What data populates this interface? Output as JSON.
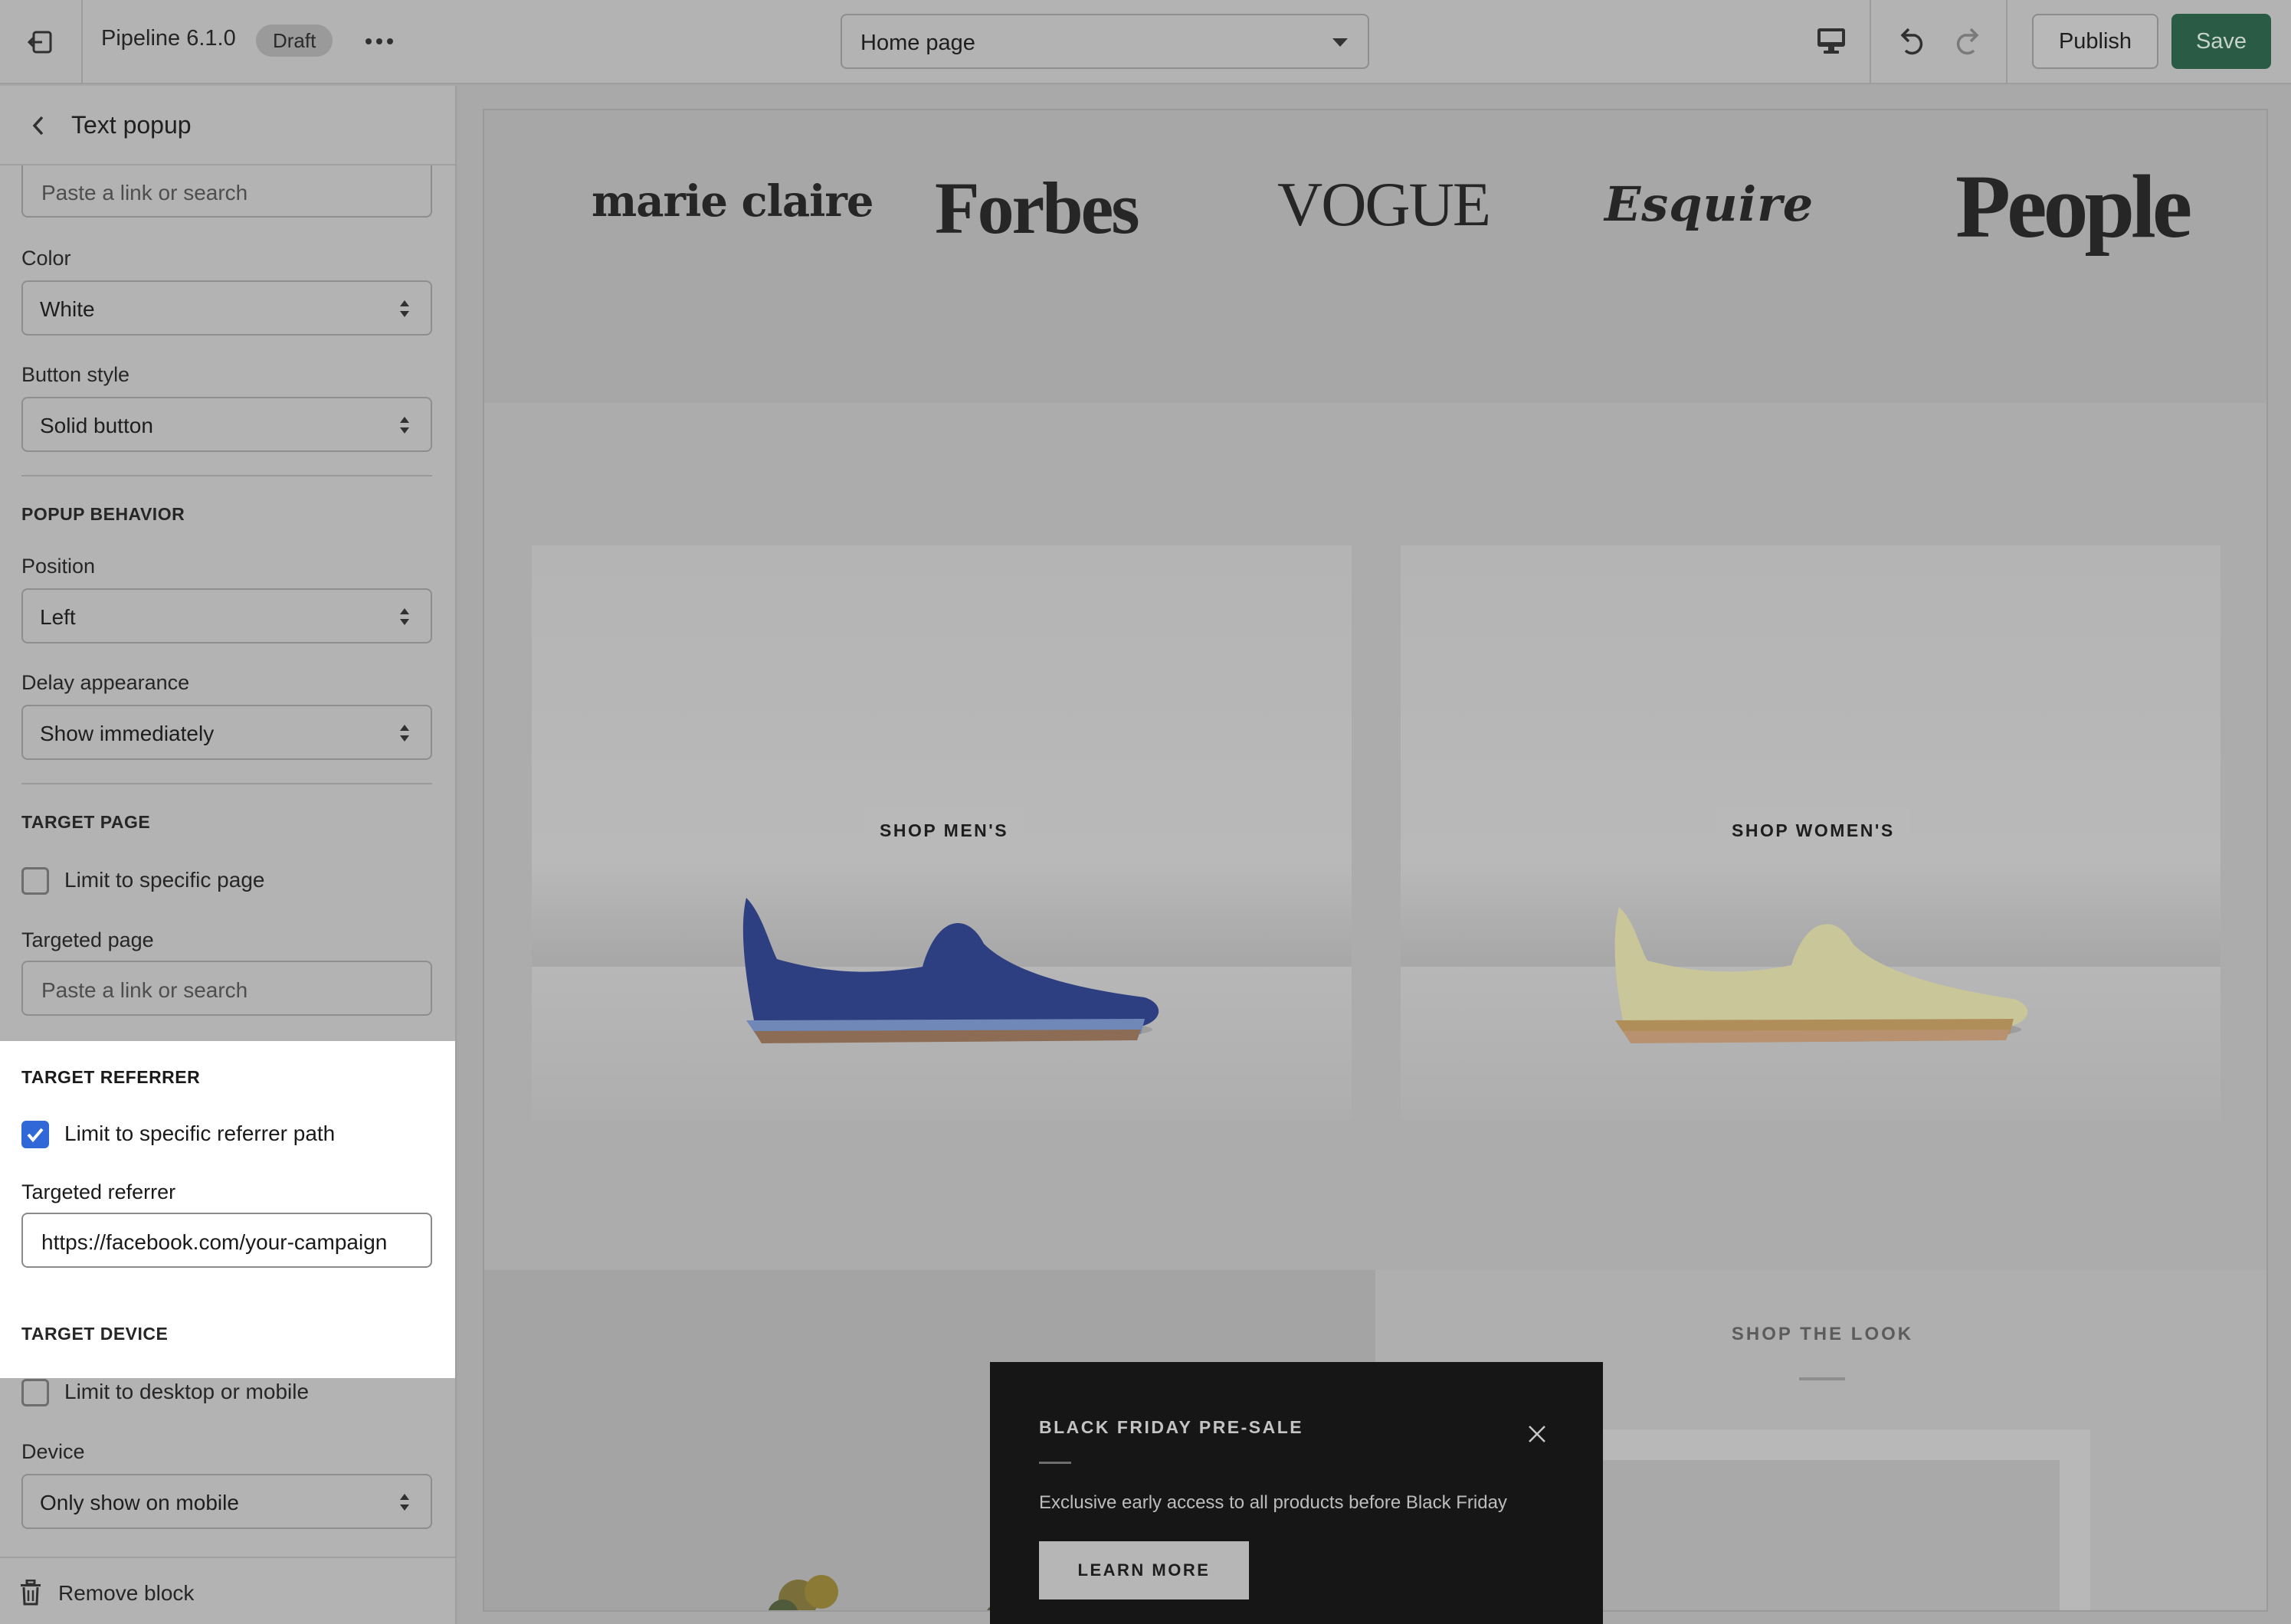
{
  "topbar": {
    "theme_name": "Pipeline 6.1.0",
    "status_badge": "Draft",
    "page_selector": "Home page",
    "publish_label": "Publish",
    "save_label": "Save"
  },
  "sidebar": {
    "title": "Text popup",
    "link_placeholder": "Paste a link or search",
    "color": {
      "label": "Color",
      "value": "White"
    },
    "button_style": {
      "label": "Button style",
      "value": "Solid button"
    },
    "popup_behavior": {
      "heading": "POPUP BEHAVIOR",
      "position": {
        "label": "Position",
        "value": "Left"
      },
      "delay": {
        "label": "Delay appearance",
        "value": "Show immediately"
      }
    },
    "target_page": {
      "heading": "TARGET PAGE",
      "checkbox_label": "Limit to specific page",
      "checked": false,
      "field_label": "Targeted page",
      "placeholder": "Paste a link or search"
    },
    "target_referrer": {
      "heading": "TARGET REFERRER",
      "checkbox_label": "Limit to specific referrer path",
      "checked": true,
      "field_label": "Targeted referrer",
      "value": "https://facebook.com/your-campaign"
    },
    "target_device": {
      "heading": "TARGET DEVICE",
      "checkbox_label": "Limit to desktop or mobile",
      "checked": false,
      "field_label": "Device",
      "value": "Only show on mobile"
    },
    "remove_label": "Remove block"
  },
  "preview": {
    "press_logos": [
      "marie claire",
      "Forbes",
      "VOGUE",
      "Esquire",
      "People"
    ],
    "collections": [
      {
        "label": "SHOP MEN'S",
        "shoe_color": "#2d3f80"
      },
      {
        "label": "SHOP WOMEN'S",
        "shoe_color": "#c9c69a"
      }
    ],
    "shop_the_look": "SHOP THE LOOK",
    "popup": {
      "title": "BLACK FRIDAY PRE-SALE",
      "text": "Exclusive early access to all products before Black Friday",
      "button": "LEARN MORE"
    }
  },
  "colors": {
    "accent_checkbox": "#3068d8",
    "save_button": "#2a5c45",
    "popup_background": "#161616"
  }
}
